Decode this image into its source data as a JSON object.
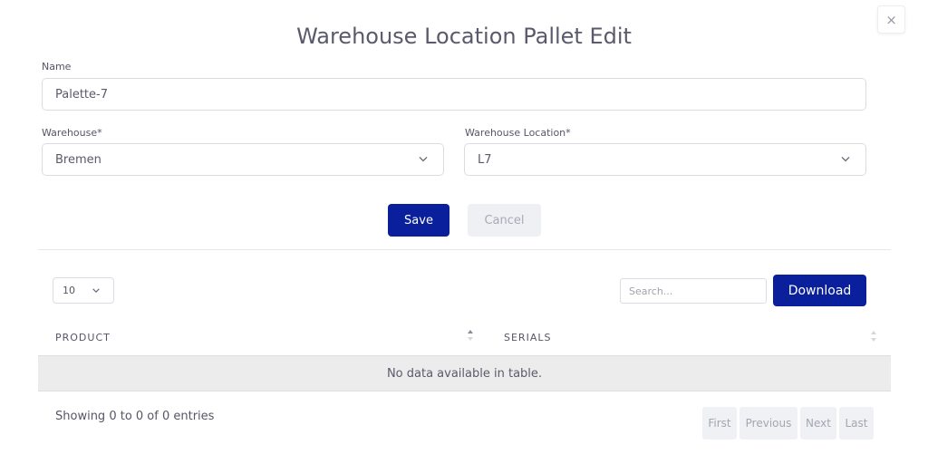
{
  "modal": {
    "title": "Warehouse Location Pallet Edit",
    "close_symbol": "×"
  },
  "form": {
    "name_label": "Name",
    "name_value": "Palette-7",
    "warehouse_label": "Warehouse*",
    "warehouse_value": "Bremen",
    "location_label": "Warehouse Location*",
    "location_value": "L7",
    "save_label": "Save",
    "cancel_label": "Cancel"
  },
  "table_controls": {
    "page_length": "10",
    "search_placeholder": "Search...",
    "download_label": "Download"
  },
  "table": {
    "columns": [
      "PRODUCT",
      "SERIALS"
    ],
    "empty_message": "No data available in table.",
    "info": "Showing 0 to 0 of 0 entries"
  },
  "pagination": {
    "first": "First",
    "previous": "Previous",
    "next": "Next",
    "last": "Last"
  },
  "colors": {
    "primary": "#0a1f9c",
    "disabled_bg": "#eef0f4",
    "empty_row_bg": "#ececec"
  }
}
